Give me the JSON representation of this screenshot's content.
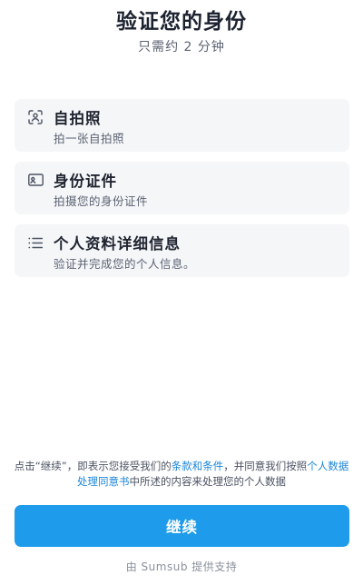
{
  "header": {
    "title": "验证您的身份",
    "subtitle": "只需约 2 分钟"
  },
  "steps": [
    {
      "title": "自拍照",
      "description": "拍一张自拍照",
      "icon": "selfie-face-icon"
    },
    {
      "title": "身份证件",
      "description": "拍摄您的身份证件",
      "icon": "id-card-icon"
    },
    {
      "title": "个人资料详细信息",
      "description": "验证并完成您的个人信息。",
      "icon": "list-icon"
    }
  ],
  "consent": {
    "prefix": "点击“继续”，即表示您接受我们的",
    "terms_link": "条款和条件",
    "middle": "，并同意我们按照",
    "privacy_link": "个人数据处理同意书",
    "suffix": "中所述的内容来处理您的个人数据"
  },
  "continue_button": {
    "label": "继续"
  },
  "footer": {
    "powered_by": "由 Sumsub 提供支持"
  },
  "colors": {
    "accent": "#1e9bea",
    "link": "#1e87d8",
    "card_bg": "#f5f6f8"
  }
}
